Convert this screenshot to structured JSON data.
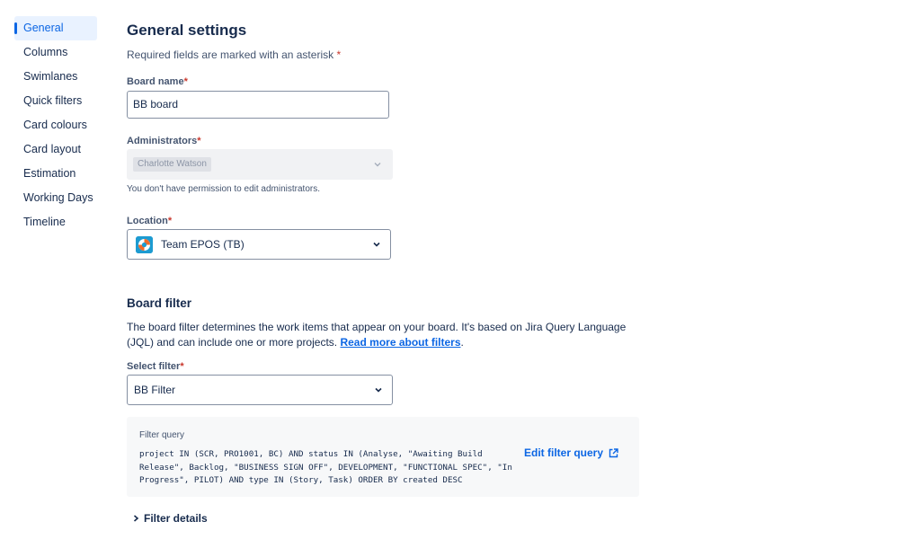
{
  "sidebar": {
    "items": [
      {
        "label": "General"
      },
      {
        "label": "Columns"
      },
      {
        "label": "Swimlanes"
      },
      {
        "label": "Quick filters"
      },
      {
        "label": "Card colours"
      },
      {
        "label": "Card layout"
      },
      {
        "label": "Estimation"
      },
      {
        "label": "Working Days"
      },
      {
        "label": "Timeline"
      }
    ],
    "active": "General"
  },
  "general": {
    "title": "General settings",
    "required_note": "Required fields are marked with an asterisk",
    "asterisk": "*",
    "board_name": {
      "label": "Board name",
      "value": "BB board"
    },
    "administrators": {
      "label": "Administrators",
      "value": "Charlotte Watson",
      "help": "You don't have permission to edit administrators."
    },
    "location": {
      "label": "Location",
      "value": "Team EPOS (TB)",
      "icon": "project-avatar-icon"
    }
  },
  "board_filter": {
    "title": "Board filter",
    "description": "The board filter determines the work items that appear on your board. It's based on Jira Query Language (JQL) and can include one or more projects.",
    "read_more": "Read more about filters",
    "period": ".",
    "select_filter": {
      "label": "Select filter",
      "value": "BB Filter"
    },
    "filter_query": {
      "title": "Filter query",
      "query": "project IN (SCR, PRO1001, BC) AND status IN (Analyse, \"Awaiting Build Release\", Backlog, \"BUSINESS SIGN OFF\", DEVELOPMENT, \"FUNCTIONAL SPEC\", \"In Progress\", PILOT) AND type IN (Story, Task) ORDER BY created DESC",
      "edit_label": "Edit filter query"
    },
    "filter_details": "Filter details"
  },
  "colors": {
    "accent": "#0c66e4",
    "required": "#c9372c",
    "text": "#172b4d"
  }
}
